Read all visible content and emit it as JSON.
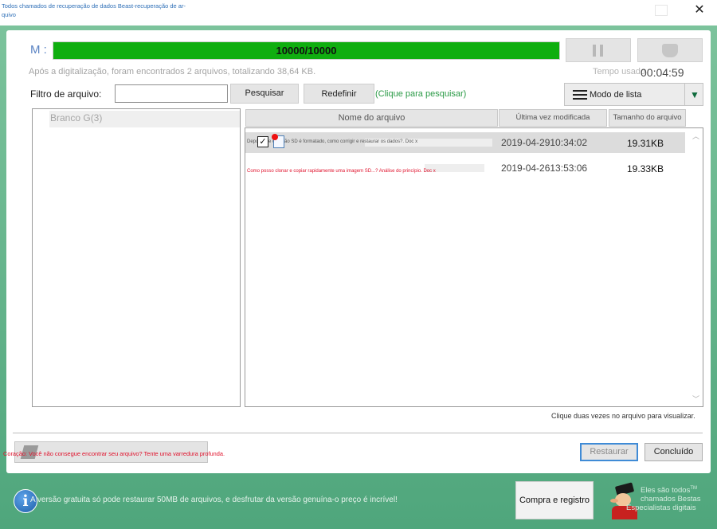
{
  "window": {
    "title": "Todos chamados de recuperação de dados Beast-recuperação de ar-quivo",
    "close_glyph": "✕"
  },
  "scan": {
    "mode_label": "M :",
    "progress_text": "10000/10000",
    "progress_fraction": 1.0,
    "status_text": "Após a digitalização, foram encontrados 2 arquivos, totalizando 38,64 KB.",
    "time_label": "Tempo usado",
    "time_value": "00:04:59",
    "pause_icon": "pause-icon",
    "stop_icon": "stop-icon"
  },
  "filter": {
    "label": "Filtro de arquivo:",
    "value": "",
    "search_label": "Pesquisar",
    "reset_label": "Redefinir",
    "hint": "(Clique para pesquisar)"
  },
  "view_mode": {
    "label": "Modo de lista",
    "icon": "list-icon",
    "caret": "▼"
  },
  "tree": {
    "items": [
      {
        "label": "Branco G(3)"
      }
    ]
  },
  "columns": {
    "name": "Nome do arquivo",
    "modified": "Última vez modificada",
    "size": "Tamanho do arquivo"
  },
  "files": [
    {
      "name": "Depois que o cartão SD é formatado, como corrigir e restaurar os dados?. Doc x",
      "modified": "2019-04-2910:34:02",
      "size": "19.31KB",
      "checked": true,
      "selected": true
    },
    {
      "name": "Como posso clonar e copiar rapidamente uma imagem SD...? Análise do princípio. Doc x",
      "modified": "2019-04-2613:53:06",
      "size": "19.33KB",
      "checked": false,
      "selected": false
    }
  ],
  "list_hint": "Clique duas vezes no arquivo para visualizar.",
  "deep_scan": {
    "text": "Coração: Você não consegue encontrar seu arquivo? Tente uma varredura profunda."
  },
  "actions": {
    "restore": "Restaurar",
    "done": "Concluído"
  },
  "footer": {
    "info_glyph": "i",
    "message": "A versão gratuita só pode restaurar 50MB de arquivos, e desfrutar da versão genuína-o preço é incrível!",
    "buy_label": "Compra e registro",
    "brand_line1": "Eles são todos",
    "brand_tm": "TM",
    "brand_line2": "chamados Bestas",
    "brand_line3": "Especialistas digitais"
  },
  "colors": {
    "progress": "#0fae0f",
    "accent": "#3f8bd6",
    "hint_green": "#2a9a46",
    "warning_red": "#e0112b",
    "footer_bg": "#4fa67c"
  }
}
